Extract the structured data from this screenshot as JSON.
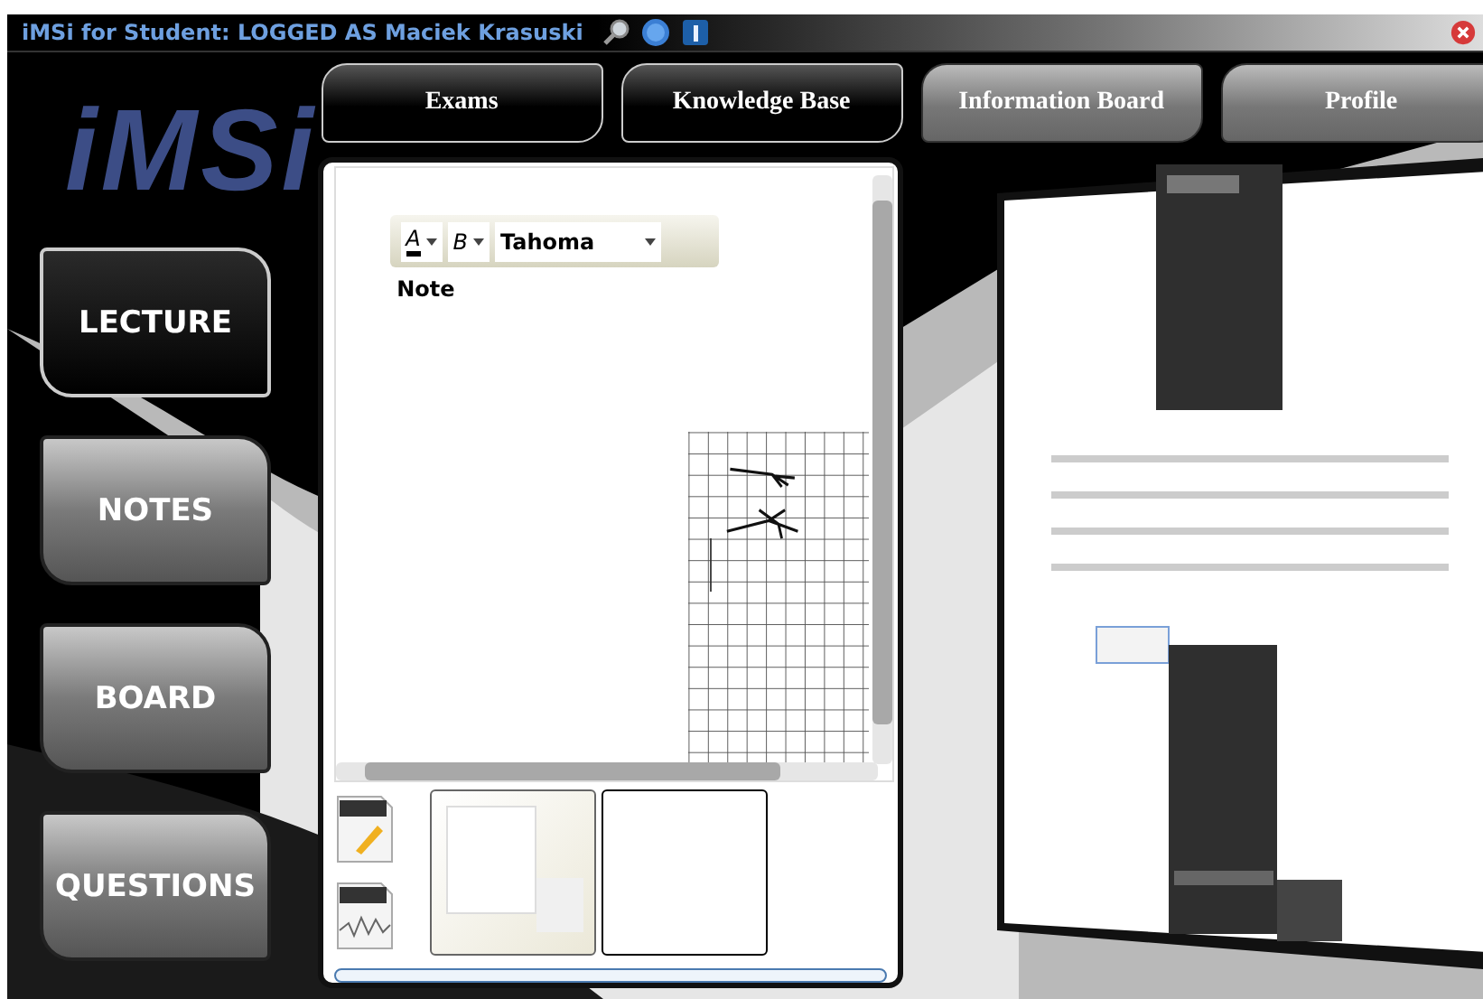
{
  "window": {
    "title": "iMSi for Student: LOGGED AS Maciek Krasuski"
  },
  "logo": "iMSi",
  "tabs": [
    {
      "label": "Exams",
      "kind": "dark"
    },
    {
      "label": "Knowledge Base",
      "kind": "dark"
    },
    {
      "label": "Information Board",
      "kind": "light"
    },
    {
      "label": "Profile",
      "kind": "light"
    }
  ],
  "nav": [
    {
      "label": "LECTURE",
      "kind": "dark"
    },
    {
      "label": "NOTES",
      "kind": "light"
    },
    {
      "label": "BOARD",
      "kind": "light"
    },
    {
      "label": "QUESTIONS",
      "kind": "light"
    }
  ],
  "notes": {
    "toolbar": {
      "color_button": "A",
      "bold_button": "B",
      "font": "Tahoma"
    },
    "title": "Note"
  },
  "thumbnails": [
    {
      "kind": "preview"
    },
    {
      "kind": "blank"
    }
  ]
}
